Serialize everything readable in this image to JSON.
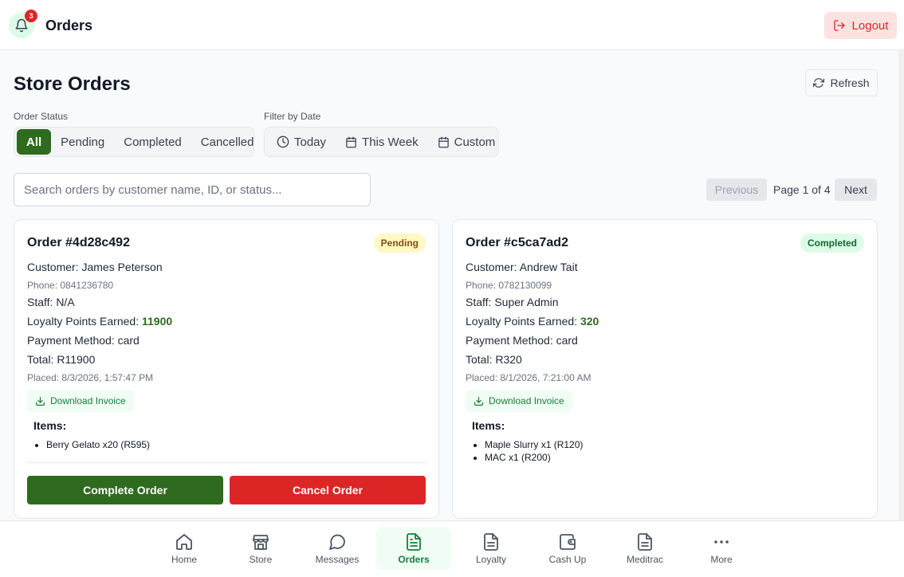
{
  "header": {
    "title": "Orders",
    "notification_count": "3",
    "logout_label": "Logout"
  },
  "main": {
    "heading": "Store Orders",
    "refresh_label": "Refresh",
    "status_filter": {
      "label": "Order Status",
      "options": [
        "All",
        "Pending",
        "Completed",
        "Cancelled"
      ],
      "selected": "All"
    },
    "date_filter": {
      "label": "Filter by Date",
      "options": [
        "Today",
        "This Week",
        "Custom"
      ]
    },
    "search": {
      "placeholder": "Search orders by customer name, ID, or status...",
      "value": ""
    },
    "pagination": {
      "previous_label": "Previous",
      "info": "Page 1 of 4",
      "next_label": "Next"
    }
  },
  "orders": [
    {
      "title": "Order #4d28c492",
      "status": "Pending",
      "customer": "Customer: James Peterson",
      "phone": "Phone: 0841236780",
      "staff": "Staff: N/A",
      "points_label": "Loyalty Points Earned: ",
      "points": "11900",
      "payment": "Payment Method: card",
      "total": "Total: R11900",
      "placed": "Placed: 8/3/2026, 1:57:47 PM",
      "download_label": "Download Invoice",
      "items_heading": "Items:",
      "items": [
        "Berry Gelato x20 (R595)"
      ],
      "complete_label": "Complete Order",
      "cancel_label": "Cancel Order"
    },
    {
      "title": "Order #c5ca7ad2",
      "status": "Completed",
      "customer": "Customer: Andrew Tait",
      "phone": "Phone: 0782130099",
      "staff": "Staff: Super Admin",
      "points_label": "Loyalty Points Earned: ",
      "points": "320",
      "payment": "Payment Method: card",
      "total": "Total: R320",
      "placed": "Placed: 8/1/2026, 7:21:00 AM",
      "download_label": "Download Invoice",
      "items_heading": "Items:",
      "items": [
        "Maple Slurry x1 (R120)",
        "MAC x1 (R200)"
      ]
    }
  ],
  "bottom_nav": {
    "items": [
      {
        "label": "Home",
        "icon": "home-icon"
      },
      {
        "label": "Store",
        "icon": "store-icon"
      },
      {
        "label": "Messages",
        "icon": "message-icon"
      },
      {
        "label": "Orders",
        "icon": "orders-icon"
      },
      {
        "label": "Loyalty",
        "icon": "document-icon"
      },
      {
        "label": "Cash Up",
        "icon": "wallet-icon"
      },
      {
        "label": "Meditrac",
        "icon": "document-icon"
      },
      {
        "label": "More",
        "icon": "more-icon"
      }
    ],
    "active": "Orders"
  },
  "colors": {
    "primary": "#2e6b1f",
    "danger": "#dc2626",
    "pending_bg": "#fef9c3",
    "completed_bg": "#dcfce7"
  }
}
